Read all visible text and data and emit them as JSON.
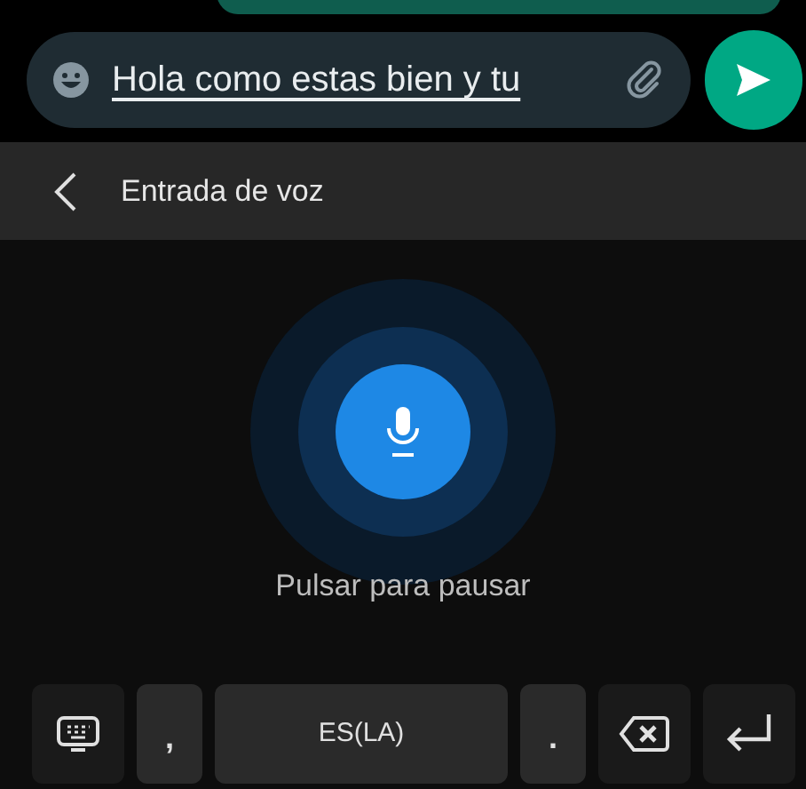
{
  "composer": {
    "value": "Hola como estas bien y tu"
  },
  "voice_input": {
    "title": "Entrada de voz",
    "hint": "Pulsar para pausar"
  },
  "keys": [
    {
      "kind": "keyboard"
    },
    {
      "kind": "text",
      "label": ","
    },
    {
      "kind": "space",
      "label": "ES(LA)"
    },
    {
      "kind": "text",
      "label": "."
    },
    {
      "kind": "backspace"
    },
    {
      "kind": "enter"
    }
  ]
}
